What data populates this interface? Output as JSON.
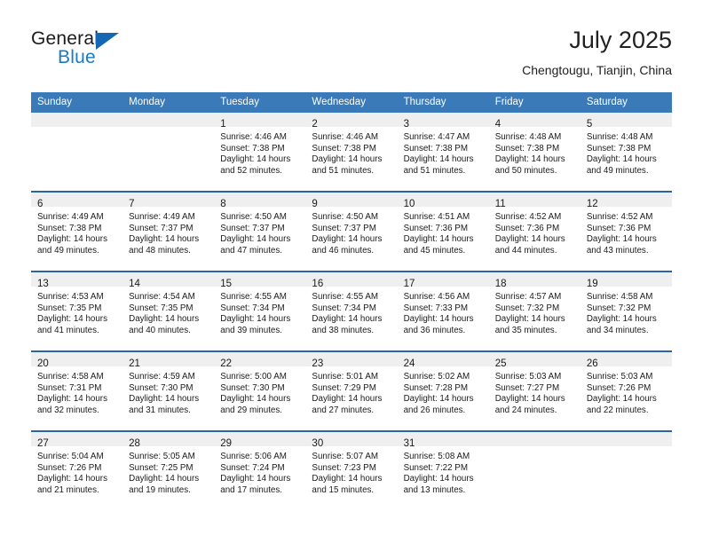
{
  "brand": {
    "name_top": "General",
    "name_bottom": "Blue",
    "triangle_icon": "blue-triangle-logo-mark",
    "accent_color": "#1a7ac4"
  },
  "header": {
    "title": "July 2025",
    "location": "Chengtougu, Tianjin, China"
  },
  "theme": {
    "header_blue": "#3a7ab8",
    "row_rule_blue": "#2b64a0",
    "daynum_band_gray": "#efefef",
    "text_color": "#1b1b1b"
  },
  "weekday_headers": [
    "Sunday",
    "Monday",
    "Tuesday",
    "Wednesday",
    "Thursday",
    "Friday",
    "Saturday"
  ],
  "weeks": [
    {
      "days": [
        {
          "empty": true,
          "num": "",
          "l1": "",
          "l2": "",
          "l3": "",
          "l4": ""
        },
        {
          "empty": true,
          "num": "",
          "l1": "",
          "l2": "",
          "l3": "",
          "l4": ""
        },
        {
          "empty": false,
          "num": "1",
          "l1": "Sunrise: 4:46 AM",
          "l2": "Sunset: 7:38 PM",
          "l3": "Daylight: 14 hours",
          "l4": "and 52 minutes."
        },
        {
          "empty": false,
          "num": "2",
          "l1": "Sunrise: 4:46 AM",
          "l2": "Sunset: 7:38 PM",
          "l3": "Daylight: 14 hours",
          "l4": "and 51 minutes."
        },
        {
          "empty": false,
          "num": "3",
          "l1": "Sunrise: 4:47 AM",
          "l2": "Sunset: 7:38 PM",
          "l3": "Daylight: 14 hours",
          "l4": "and 51 minutes."
        },
        {
          "empty": false,
          "num": "4",
          "l1": "Sunrise: 4:48 AM",
          "l2": "Sunset: 7:38 PM",
          "l3": "Daylight: 14 hours",
          "l4": "and 50 minutes."
        },
        {
          "empty": false,
          "num": "5",
          "l1": "Sunrise: 4:48 AM",
          "l2": "Sunset: 7:38 PM",
          "l3": "Daylight: 14 hours",
          "l4": "and 49 minutes."
        }
      ]
    },
    {
      "days": [
        {
          "empty": false,
          "num": "6",
          "l1": "Sunrise: 4:49 AM",
          "l2": "Sunset: 7:38 PM",
          "l3": "Daylight: 14 hours",
          "l4": "and 49 minutes."
        },
        {
          "empty": false,
          "num": "7",
          "l1": "Sunrise: 4:49 AM",
          "l2": "Sunset: 7:37 PM",
          "l3": "Daylight: 14 hours",
          "l4": "and 48 minutes."
        },
        {
          "empty": false,
          "num": "8",
          "l1": "Sunrise: 4:50 AM",
          "l2": "Sunset: 7:37 PM",
          "l3": "Daylight: 14 hours",
          "l4": "and 47 minutes."
        },
        {
          "empty": false,
          "num": "9",
          "l1": "Sunrise: 4:50 AM",
          "l2": "Sunset: 7:37 PM",
          "l3": "Daylight: 14 hours",
          "l4": "and 46 minutes."
        },
        {
          "empty": false,
          "num": "10",
          "l1": "Sunrise: 4:51 AM",
          "l2": "Sunset: 7:36 PM",
          "l3": "Daylight: 14 hours",
          "l4": "and 45 minutes."
        },
        {
          "empty": false,
          "num": "11",
          "l1": "Sunrise: 4:52 AM",
          "l2": "Sunset: 7:36 PM",
          "l3": "Daylight: 14 hours",
          "l4": "and 44 minutes."
        },
        {
          "empty": false,
          "num": "12",
          "l1": "Sunrise: 4:52 AM",
          "l2": "Sunset: 7:36 PM",
          "l3": "Daylight: 14 hours",
          "l4": "and 43 minutes."
        }
      ]
    },
    {
      "days": [
        {
          "empty": false,
          "num": "13",
          "l1": "Sunrise: 4:53 AM",
          "l2": "Sunset: 7:35 PM",
          "l3": "Daylight: 14 hours",
          "l4": "and 41 minutes."
        },
        {
          "empty": false,
          "num": "14",
          "l1": "Sunrise: 4:54 AM",
          "l2": "Sunset: 7:35 PM",
          "l3": "Daylight: 14 hours",
          "l4": "and 40 minutes."
        },
        {
          "empty": false,
          "num": "15",
          "l1": "Sunrise: 4:55 AM",
          "l2": "Sunset: 7:34 PM",
          "l3": "Daylight: 14 hours",
          "l4": "and 39 minutes."
        },
        {
          "empty": false,
          "num": "16",
          "l1": "Sunrise: 4:55 AM",
          "l2": "Sunset: 7:34 PM",
          "l3": "Daylight: 14 hours",
          "l4": "and 38 minutes."
        },
        {
          "empty": false,
          "num": "17",
          "l1": "Sunrise: 4:56 AM",
          "l2": "Sunset: 7:33 PM",
          "l3": "Daylight: 14 hours",
          "l4": "and 36 minutes."
        },
        {
          "empty": false,
          "num": "18",
          "l1": "Sunrise: 4:57 AM",
          "l2": "Sunset: 7:32 PM",
          "l3": "Daylight: 14 hours",
          "l4": "and 35 minutes."
        },
        {
          "empty": false,
          "num": "19",
          "l1": "Sunrise: 4:58 AM",
          "l2": "Sunset: 7:32 PM",
          "l3": "Daylight: 14 hours",
          "l4": "and 34 minutes."
        }
      ]
    },
    {
      "days": [
        {
          "empty": false,
          "num": "20",
          "l1": "Sunrise: 4:58 AM",
          "l2": "Sunset: 7:31 PM",
          "l3": "Daylight: 14 hours",
          "l4": "and 32 minutes."
        },
        {
          "empty": false,
          "num": "21",
          "l1": "Sunrise: 4:59 AM",
          "l2": "Sunset: 7:30 PM",
          "l3": "Daylight: 14 hours",
          "l4": "and 31 minutes."
        },
        {
          "empty": false,
          "num": "22",
          "l1": "Sunrise: 5:00 AM",
          "l2": "Sunset: 7:30 PM",
          "l3": "Daylight: 14 hours",
          "l4": "and 29 minutes."
        },
        {
          "empty": false,
          "num": "23",
          "l1": "Sunrise: 5:01 AM",
          "l2": "Sunset: 7:29 PM",
          "l3": "Daylight: 14 hours",
          "l4": "and 27 minutes."
        },
        {
          "empty": false,
          "num": "24",
          "l1": "Sunrise: 5:02 AM",
          "l2": "Sunset: 7:28 PM",
          "l3": "Daylight: 14 hours",
          "l4": "and 26 minutes."
        },
        {
          "empty": false,
          "num": "25",
          "l1": "Sunrise: 5:03 AM",
          "l2": "Sunset: 7:27 PM",
          "l3": "Daylight: 14 hours",
          "l4": "and 24 minutes."
        },
        {
          "empty": false,
          "num": "26",
          "l1": "Sunrise: 5:03 AM",
          "l2": "Sunset: 7:26 PM",
          "l3": "Daylight: 14 hours",
          "l4": "and 22 minutes."
        }
      ]
    },
    {
      "days": [
        {
          "empty": false,
          "num": "27",
          "l1": "Sunrise: 5:04 AM",
          "l2": "Sunset: 7:26 PM",
          "l3": "Daylight: 14 hours",
          "l4": "and 21 minutes."
        },
        {
          "empty": false,
          "num": "28",
          "l1": "Sunrise: 5:05 AM",
          "l2": "Sunset: 7:25 PM",
          "l3": "Daylight: 14 hours",
          "l4": "and 19 minutes."
        },
        {
          "empty": false,
          "num": "29",
          "l1": "Sunrise: 5:06 AM",
          "l2": "Sunset: 7:24 PM",
          "l3": "Daylight: 14 hours",
          "l4": "and 17 minutes."
        },
        {
          "empty": false,
          "num": "30",
          "l1": "Sunrise: 5:07 AM",
          "l2": "Sunset: 7:23 PM",
          "l3": "Daylight: 14 hours",
          "l4": "and 15 minutes."
        },
        {
          "empty": false,
          "num": "31",
          "l1": "Sunrise: 5:08 AM",
          "l2": "Sunset: 7:22 PM",
          "l3": "Daylight: 14 hours",
          "l4": "and 13 minutes."
        },
        {
          "empty": true,
          "num": "",
          "l1": "",
          "l2": "",
          "l3": "",
          "l4": ""
        },
        {
          "empty": true,
          "num": "",
          "l1": "",
          "l2": "",
          "l3": "",
          "l4": ""
        }
      ]
    }
  ]
}
